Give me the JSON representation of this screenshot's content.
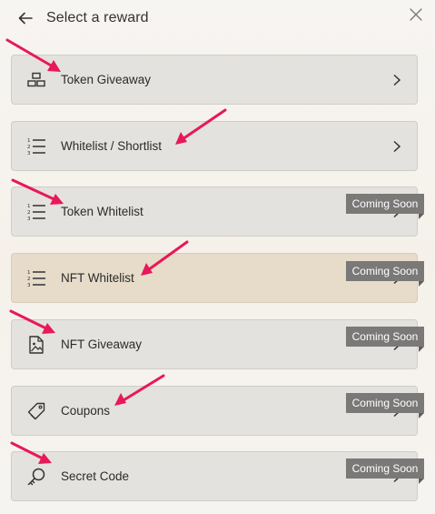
{
  "header": {
    "title": "Select a reward",
    "back_icon": "arrow-left-icon",
    "close_icon": "close-icon"
  },
  "items": [
    {
      "label": "Token Giveaway",
      "icon": "gold-bars-icon",
      "chevron": true
    },
    {
      "label": "Whitelist / Shortlist",
      "icon": "numbered-list-icon",
      "chevron": true
    },
    {
      "label": "Token Whitelist",
      "icon": "numbered-list-icon",
      "badge": "Coming Soon"
    },
    {
      "label": "NFT Whitelist",
      "icon": "numbered-list-icon",
      "badge": "Coming Soon",
      "highlighted": true
    },
    {
      "label": "NFT Giveaway",
      "icon": "image-file-icon",
      "badge": "Coming Soon"
    },
    {
      "label": "Coupons",
      "icon": "tag-icon",
      "badge": "Coming Soon"
    },
    {
      "label": "Secret Code",
      "icon": "key-icon",
      "badge": "Coming Soon"
    }
  ],
  "colors": {
    "annotation_arrow": "#e8185a",
    "highlight_background": "#e6dcc9",
    "badge_background": "#7a7978"
  }
}
